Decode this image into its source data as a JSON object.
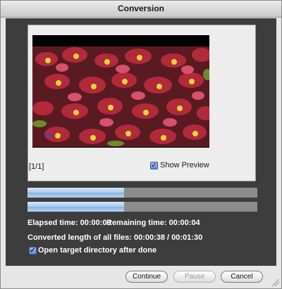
{
  "window": {
    "title": "Conversion"
  },
  "preview": {
    "file_counter": "[1/1]",
    "show_preview_label": "Show Preview",
    "show_preview_checked": true
  },
  "progress": {
    "current_file_fraction": 0.42,
    "all_files_fraction": 0.42
  },
  "status": {
    "elapsed_label": "Elapsed time:",
    "elapsed_value": "00:00:03",
    "remaining_label": "Remaining time:",
    "remaining_value": "00:00:04",
    "converted_label": "Converted length of all files:",
    "converted_value": "00:00:38 / 00:01:30"
  },
  "options": {
    "open_dir_label": "Open target directory after done",
    "open_dir_checked": true
  },
  "buttons": {
    "continue_label": "Continue",
    "pause_label": "Pause",
    "cancel_label": "Cancel"
  },
  "colors": {
    "panel_bg": "#3d3d3d",
    "progress_fill": "#a9c9ec",
    "progress_track": "#8c8c8c"
  }
}
